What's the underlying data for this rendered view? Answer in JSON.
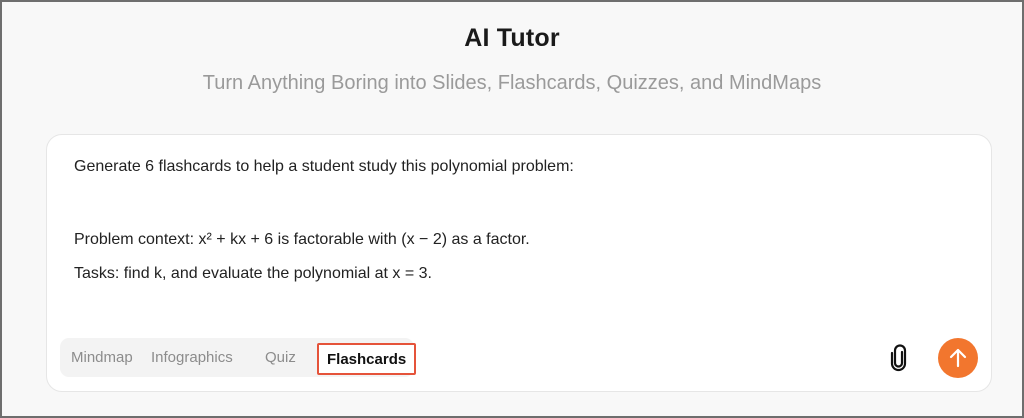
{
  "app": {
    "title": "AI Tutor",
    "subtitle": "Turn Anything Boring into Slides, Flashcards, Quizzes, and MindMaps"
  },
  "prompt": {
    "line1": "Generate 6 flashcards to help a student study this polynomial problem:",
    "line2": "Problem context: x² + kx + 6 is factorable with (x − 2) as a factor.",
    "line3": "Tasks: find k, and evaluate the polynomial at x = 3."
  },
  "modes": {
    "mindmap": "Mindmap",
    "infographics": "Infographics",
    "quiz": "Quiz",
    "flashcards": "Flashcards",
    "selected": "Flashcards"
  },
  "icons": {
    "attach": "paperclip-icon",
    "send": "arrow-up-icon"
  },
  "colors": {
    "accent": "#f2762e",
    "selected_outline": "#e5533a"
  }
}
